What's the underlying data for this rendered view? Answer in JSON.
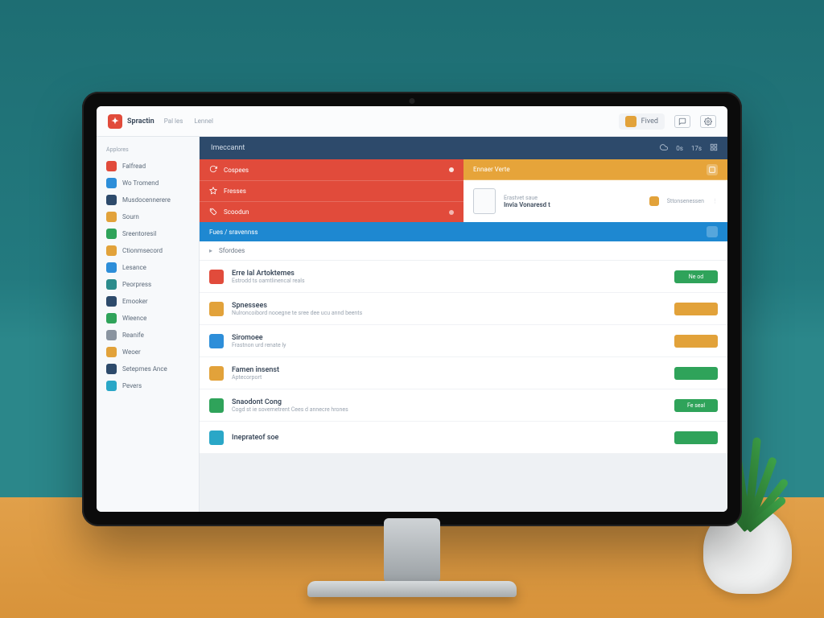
{
  "brand": {
    "name": "Spractin"
  },
  "chrome": {
    "tabs": [
      "Pal les",
      "Lennel"
    ],
    "user_label": "Fived",
    "icons": [
      "chat",
      "settings"
    ]
  },
  "sidebar": {
    "section_a": "Applores",
    "items": [
      {
        "label": "Falfread",
        "color": "c-red"
      },
      {
        "label": "Wo Tromend",
        "color": "c-blue"
      },
      {
        "label": "Musdocennerere",
        "color": "c-nav"
      },
      {
        "label": "Sourn",
        "color": "c-gold"
      },
      {
        "label": "Sreentoresil",
        "color": "c-green"
      },
      {
        "label": "Ctionmsecord",
        "color": "c-gold"
      },
      {
        "label": "Lesance",
        "color": "c-blue"
      },
      {
        "label": "Peorpress",
        "color": "c-teal"
      },
      {
        "label": "Emooker",
        "color": "c-nav"
      },
      {
        "label": "Wleence",
        "color": "c-green"
      },
      {
        "label": "Reanife",
        "color": "c-gray"
      },
      {
        "label": "Weoer",
        "color": "c-gold"
      },
      {
        "label": "Setepmes Ance",
        "color": "c-nav"
      },
      {
        "label": "Pevers",
        "color": "c-cyan"
      }
    ]
  },
  "ribbon": {
    "title": "Imeccannt",
    "right": [
      "0s",
      "17s",
      ""
    ]
  },
  "summary": {
    "left": [
      {
        "label": "Cospees"
      },
      {
        "label": "Fresses"
      },
      {
        "label": "Scoodun"
      }
    ],
    "right_header": "Ennaer Verte",
    "right_title": "Erastvet saue",
    "right_item_title": "Invia Vonaresd t",
    "right_item_sub": "",
    "right_meta": "Sttonsenessen"
  },
  "list": {
    "header": "Fues / sravennss",
    "filter_label": "Sfordoes",
    "items": [
      {
        "color": "c-red",
        "title": "Erre Ial Artoktemes",
        "sub": "Estrodd ts oamtlinencal reals",
        "status": "Ne od",
        "status_cls": "s-green"
      },
      {
        "color": "c-gold",
        "title": "Spnessees",
        "sub": "Nulroncoibord nooegne te sree dee ucu annd beents",
        "status": "",
        "status_cls": "s-gold"
      },
      {
        "color": "c-blue",
        "title": "Siromoee",
        "sub": "Frastnon urd renate ly",
        "status": "",
        "status_cls": "s-gold"
      },
      {
        "color": "c-gold",
        "title": "Famen insenst",
        "sub": "Aptecorport",
        "status": "",
        "status_cls": "s-green"
      },
      {
        "color": "c-green",
        "title": "Snaodont Cong",
        "sub": "Cogd st ie sovernetrent Cees d annecre hrones",
        "status": "Fe seal",
        "status_cls": "s-green"
      },
      {
        "color": "c-cyan",
        "title": "Ineprateof soe",
        "sub": "",
        "status": "",
        "status_cls": "s-green"
      }
    ]
  }
}
